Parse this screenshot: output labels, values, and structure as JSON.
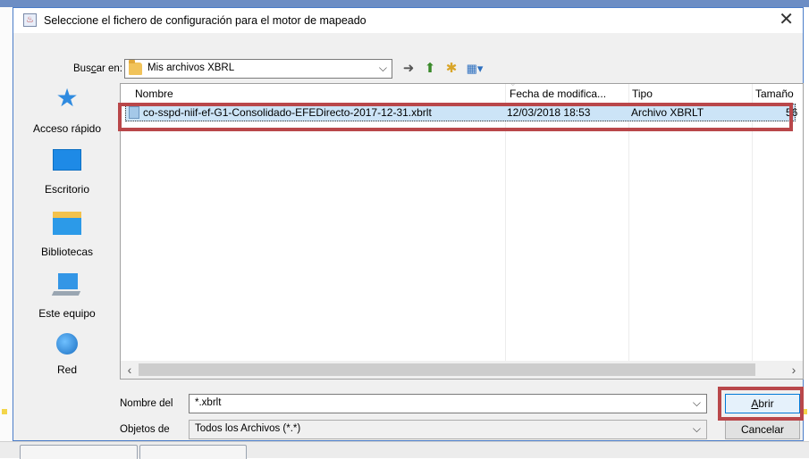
{
  "dialog": {
    "title": "Seleccione el fichero de configuración para el motor de mapeado",
    "close_glyph": "✕"
  },
  "lookin": {
    "label_pre": "Bus",
    "label_mnemonic": "c",
    "label_post": "ar en:",
    "folder": "Mis archivos XBRL",
    "arrow": "⌵"
  },
  "toolbar": {
    "back_icon": "back-icon",
    "up_icon": "up-folder-icon",
    "new_folder_icon": "new-folder-icon",
    "view_menu_icon": "view-menu-icon"
  },
  "places": [
    {
      "label": "Acceso rápido",
      "icon": "star-icon"
    },
    {
      "label": "Escritorio",
      "icon": "desktop-icon"
    },
    {
      "label": "Bibliotecas",
      "icon": "libraries-icon"
    },
    {
      "label": "Este equipo",
      "icon": "computer-icon"
    },
    {
      "label": "Red",
      "icon": "network-icon"
    }
  ],
  "columns": {
    "name": "Nombre",
    "date": "Fecha de modifica...",
    "type": "Tipo",
    "size": "Tamaño"
  },
  "files": [
    {
      "name": "co-sspd-niif-ef-G1-Consolidado-EFEDirecto-2017-12-31.xbrlt",
      "date": "12/03/2018 18:53",
      "type": "Archivo XBRLT",
      "size": "56"
    }
  ],
  "filename": {
    "label": "Nombre del",
    "value": "*.xbrlt"
  },
  "filetype": {
    "label": "Objetos de",
    "value": "Todos los Archivos (*.*)"
  },
  "buttons": {
    "open_mnemonic": "A",
    "open_rest": "brir",
    "cancel": "Cancelar"
  },
  "colors": {
    "highlight_outline": "#b9474a",
    "selection": "#cce4f7",
    "accent": "#0078d7"
  }
}
